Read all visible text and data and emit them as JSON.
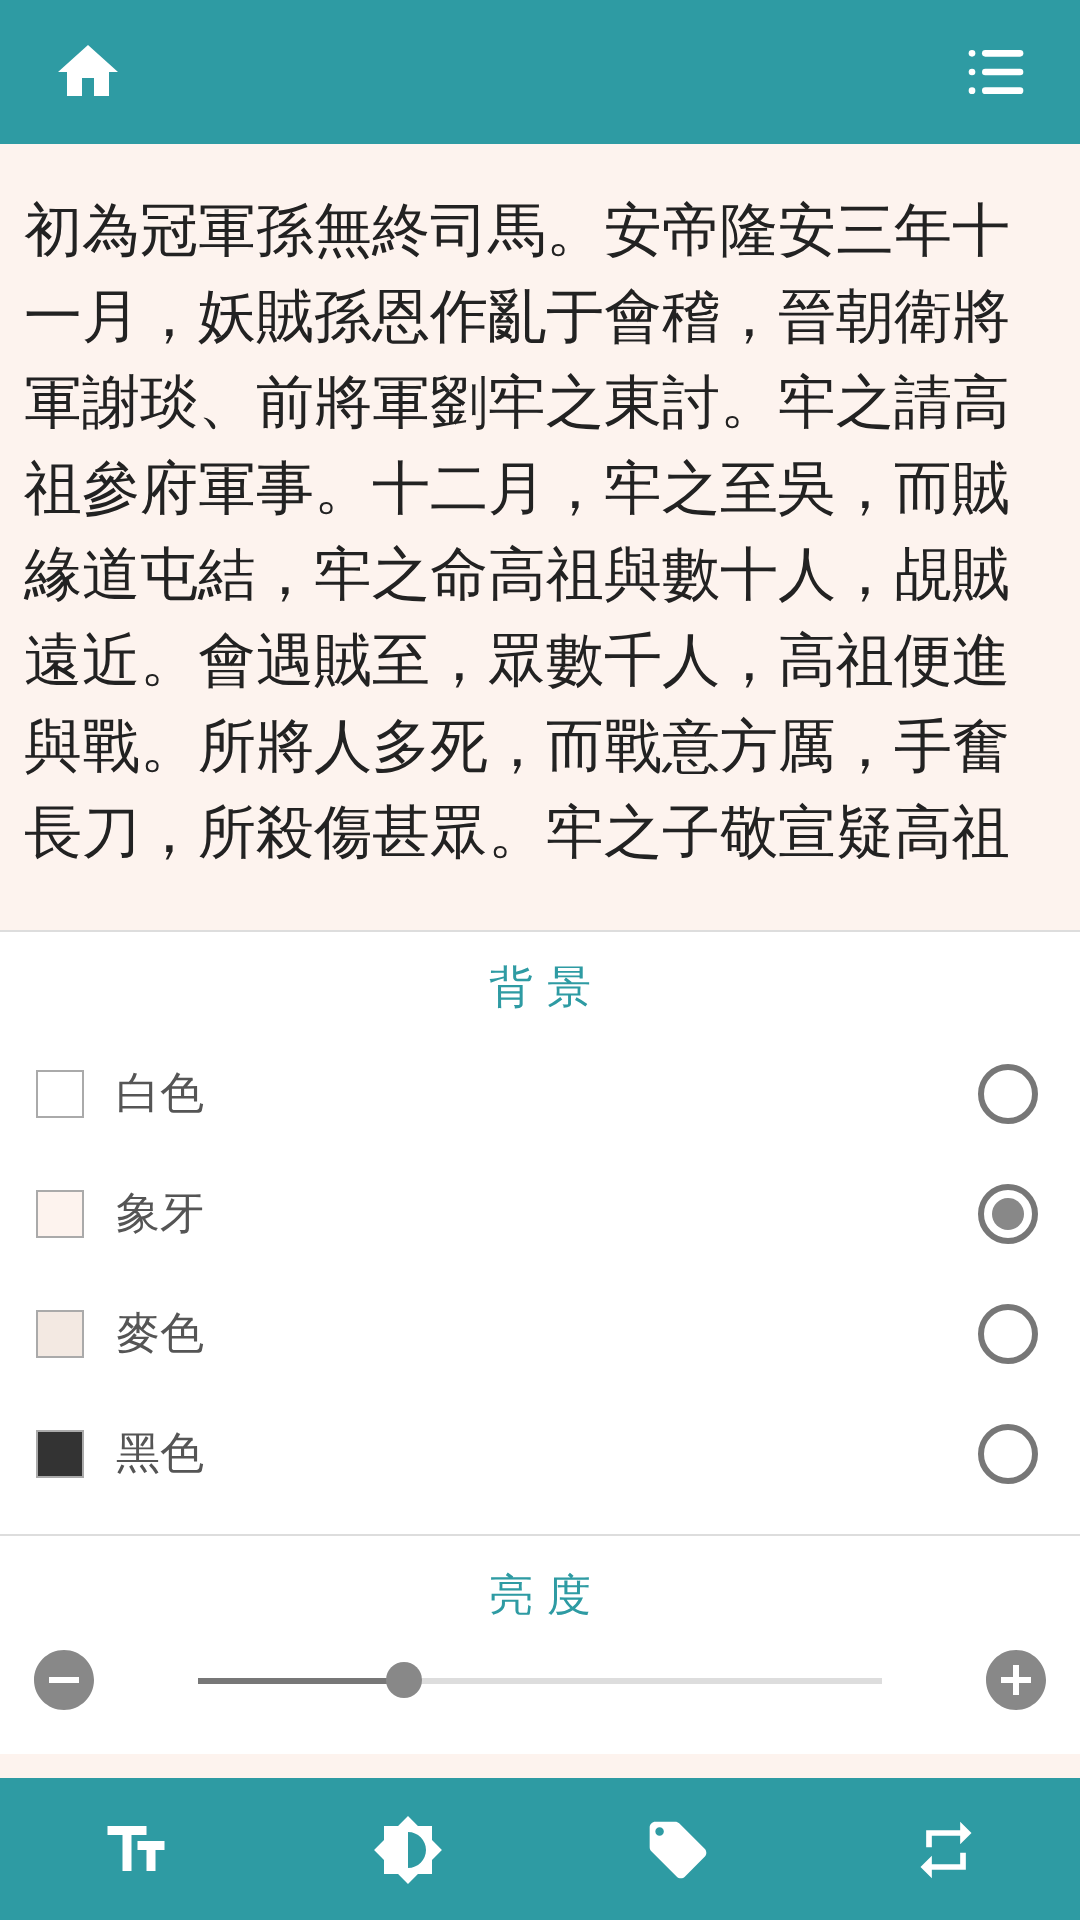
{
  "reader": {
    "text": "初為冠軍孫無終司馬。安帝隆安三年十一月，妖賊孫恩作亂于會稽，晉朝衛將軍謝琰、前將軍劉牢之東討。牢之請高祖參府軍事。十二月，牢之至吳，而賊緣道屯結，牢之命高祖與數十人，覘賊遠近。會遇賊至，眾數千人，高祖便進與戰。所將人多死，而戰意方厲，手奮長刀，所殺傷甚眾。牢之子敬宣疑高祖"
  },
  "background": {
    "title": "背景",
    "options": [
      {
        "label": "白色",
        "color": "#ffffff",
        "selected": false
      },
      {
        "label": "象牙",
        "color": "#fdf3ee",
        "selected": true
      },
      {
        "label": "麥色",
        "color": "#f3e9e2",
        "selected": false
      },
      {
        "label": "黑色",
        "color": "#333333",
        "selected": false
      }
    ]
  },
  "brightness": {
    "title": "亮度",
    "level": 0.3
  }
}
